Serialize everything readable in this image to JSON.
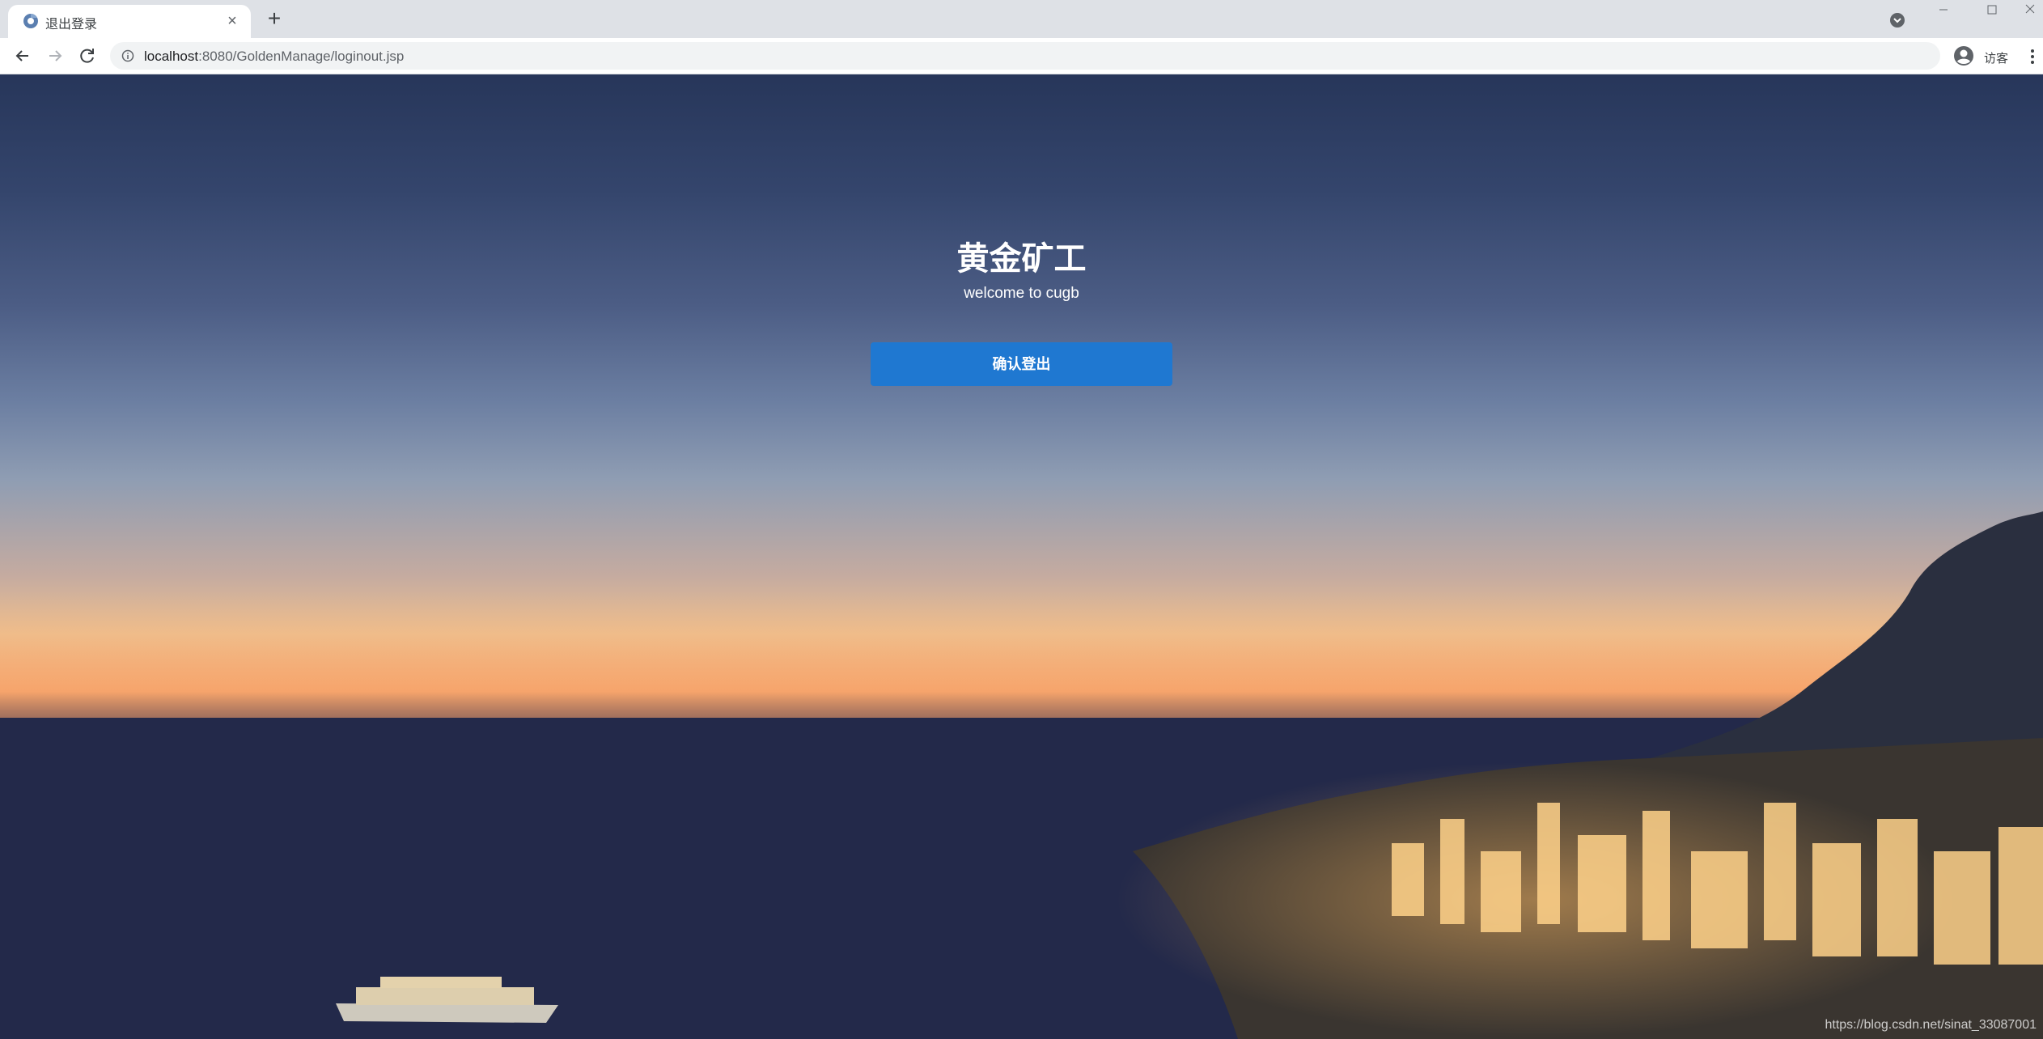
{
  "browser": {
    "tab_title": "退出登录",
    "new_tab_symbol": "+",
    "close_tab_symbol": "×",
    "url_host": "localhost",
    "url_path": ":8080/GoldenManage/loginout.jsp",
    "profile_label": "访客"
  },
  "page": {
    "title": "黄金矿工",
    "subtitle": "welcome to cugb",
    "confirm_button_label": "确认登出",
    "watermark": "https://blog.csdn.net/sinat_33087001"
  },
  "colors": {
    "button": "#1f78d1",
    "tabstrip": "#dee1e6",
    "omnibox": "#f1f3f4"
  },
  "icons": [
    "chrome-favicon-icon",
    "close-icon",
    "plus-icon",
    "tab-search-icon",
    "minimize-icon",
    "maximize-icon",
    "window-close-icon",
    "back-arrow-icon",
    "forward-arrow-icon",
    "reload-icon",
    "info-icon",
    "avatar-icon",
    "kebab-menu-icon"
  ]
}
